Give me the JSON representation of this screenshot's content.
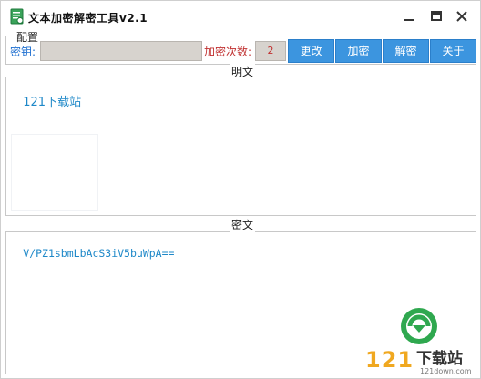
{
  "window": {
    "title": "文本加密解密工具v2.1"
  },
  "config": {
    "group_title": "配置",
    "key_label": "密钥:",
    "key_value": "",
    "count_label": "加密次数:",
    "count_value": "2",
    "buttons": {
      "change": "更改",
      "encrypt": "加密",
      "decrypt": "解密",
      "about": "关于"
    }
  },
  "plaintext": {
    "label": "明文",
    "content": "121下载站"
  },
  "ciphertext": {
    "label": "密文",
    "content": "V/PZ1sbmLbAcS3iV5buWpA=="
  },
  "watermark": {
    "number": "121",
    "brand": "下载站",
    "url": "121down.com"
  },
  "colors": {
    "accent_button": "#3c95df",
    "label_blue": "#1e6fd0",
    "label_red": "#c03030",
    "text_cyan": "#1e88c8",
    "readonly_field": "#d7d3ce"
  },
  "icons": [
    "app-icon",
    "minimize-icon",
    "maximize-icon",
    "close-icon",
    "logo-icon"
  ]
}
